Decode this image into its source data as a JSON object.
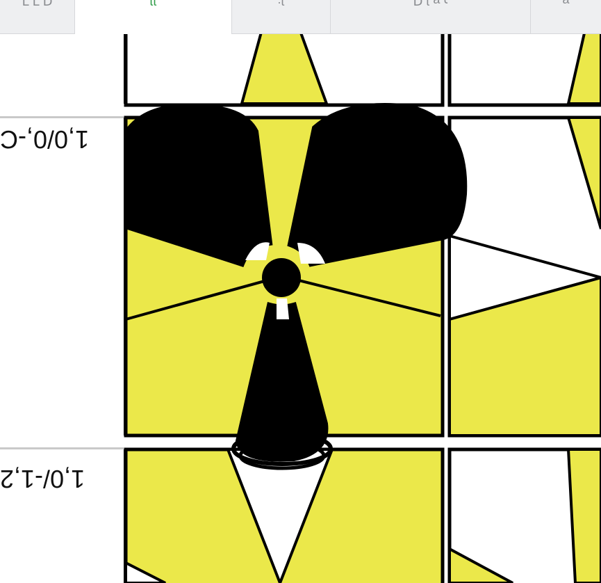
{
  "tabs": [
    {
      "label": "ᗡ ꓶ ꓶ",
      "active": false
    },
    {
      "label": "ʇʇ",
      "active": true
    },
    {
      "label": "ʇ:",
      "active": false
    },
    {
      "label": "ɿ  ɐ  ʇ  ꓷ",
      "active": false
    },
    {
      "label": "ɐ",
      "active": false
    }
  ],
  "rows": [
    {
      "label": ""
    },
    {
      "label": "1,0/0,-C"
    },
    {
      "label": "1,0/-1,2"
    }
  ],
  "colors": {
    "tile_yellow": "#ebe84a",
    "outline": "#000000",
    "separator": "#c9c9c9",
    "tab_bg": "#eeeff1",
    "active_tab_accent": "#2e9c47"
  },
  "canvas": {
    "drawing": "radiation-trefoil-sketch"
  }
}
